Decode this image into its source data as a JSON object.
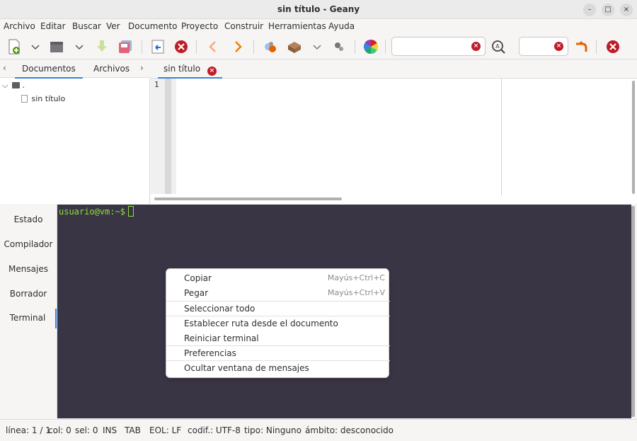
{
  "window": {
    "title": "sin título - Geany",
    "minimize_symbol": "–",
    "maximize_symbol": "□",
    "close_symbol": "×"
  },
  "menubar": [
    "Archivo",
    "Editar",
    "Buscar",
    "Ver",
    "Documento",
    "Proyecto",
    "Construir",
    "Herramientas",
    "Ayuda"
  ],
  "toolbar": {
    "icons": [
      "new-document-icon",
      "dropdown-arrow-icon",
      "open-folder-icon",
      "dropdown-arrow-icon",
      "save-icon",
      "save-all-icon",
      "revert-icon",
      "close-document-icon",
      "navigate-back-icon",
      "navigate-forward-icon",
      "compile-icon",
      "build-icon",
      "dropdown-arrow-icon",
      "execute-icon",
      "color-chooser-icon",
      "search-field",
      "find-icon",
      "goto-line-field",
      "jump-icon",
      "quit-icon"
    ],
    "search_value": "",
    "goto_value": ""
  },
  "sidebar": {
    "tabs": [
      "Documentos",
      "Archivos"
    ],
    "active_tab": "Documentos",
    "tree": {
      "folder_label": ".",
      "expander": "⌵",
      "document": "sin título"
    }
  },
  "editor": {
    "tabs": [
      {
        "label": "sin título",
        "active": true
      }
    ],
    "line_numbers": [
      "1"
    ]
  },
  "messages": {
    "tabs": [
      "Estado",
      "Compilador",
      "Mensajes",
      "Borrador",
      "Terminal"
    ],
    "active_tab": "Terminal"
  },
  "terminal": {
    "prompt": "usuario@vm:~$",
    "background": "#3a3545",
    "prompt_color": "#8ae234"
  },
  "context_menu": {
    "items": [
      {
        "label": "Copiar",
        "accel": "Mayús+Ctrl+C"
      },
      {
        "label": "Pegar",
        "accel": "Mayús+Ctrl+V"
      },
      {
        "label": "Seleccionar todo",
        "accel": ""
      },
      {
        "label": "Establecer ruta desde el documento",
        "accel": ""
      },
      {
        "label": "Reiniciar terminal",
        "accel": ""
      },
      {
        "label": "Preferencias",
        "accel": ""
      },
      {
        "label": "Ocultar ventana de mensajes",
        "accel": ""
      }
    ]
  },
  "statusbar": [
    "línea: 1 / 1",
    "col: 0",
    "sel: 0",
    "INS",
    "TAB",
    "EOL: LF",
    "codif.: UTF-8",
    "tipo: Ninguno",
    "ámbito: desconocido"
  ],
  "colors": {
    "accent": "#3584e4",
    "close_red": "#c01c28",
    "window_bg": "#f6f5f4"
  }
}
